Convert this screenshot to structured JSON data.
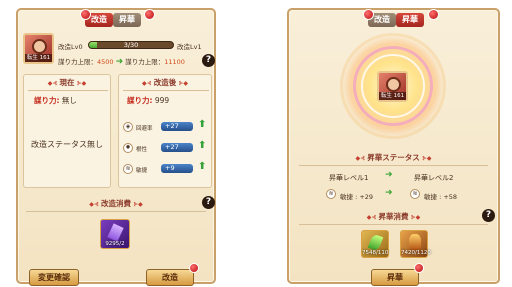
{
  "left": {
    "tabs": [
      {
        "label": "改造"
      },
      {
        "label": "昇華"
      }
    ],
    "hero": {
      "level_badge": "転生 161"
    },
    "progress": {
      "from_label": "改造Lv0",
      "to_label": "改造Lv1",
      "text": "3/30",
      "fraction": 0.1
    },
    "limit": {
      "label": "謀り力上限：",
      "from": "4500",
      "to_label": "謀り力上限：",
      "to": "11100"
    },
    "current": {
      "header": "現在",
      "ability_label": "謀り力:",
      "ability_value": "無し",
      "status_text": "改造ステータス無し"
    },
    "after": {
      "header": "改造後",
      "ability_label": "謀り力:",
      "ability_value": "999",
      "stats": [
        {
          "name": "回避率",
          "value": "+27",
          "icon": "shield-icon"
        },
        {
          "name": "根性",
          "value": "+27",
          "icon": "fire-icon"
        },
        {
          "name": "敏捷",
          "value": "+9",
          "icon": "wind-icon"
        }
      ]
    },
    "cost": {
      "header": "改造消費",
      "item_count": "9295/2"
    },
    "buttons": {
      "confirm": "変更確認",
      "modify": "改造"
    }
  },
  "right": {
    "tabs": [
      {
        "label": "改造"
      },
      {
        "label": "昇華"
      }
    ],
    "hero": {
      "level_badge": "転生 161"
    },
    "sublimation": {
      "header": "昇華ステータス",
      "from_level": "昇華レベル1",
      "to_level": "昇華レベル2",
      "stat_name": "敏捷",
      "from_value": "+29",
      "to_value": "+58"
    },
    "cost": {
      "header": "昇華消費",
      "items": [
        {
          "count": "7548/110",
          "icon": "leaf-gem-icon"
        },
        {
          "count": "7420/1120",
          "icon": "flame-statue-icon"
        }
      ]
    },
    "buttons": {
      "sublimate": "昇華"
    }
  },
  "colors": {
    "panel_bg": "#f6e8cb",
    "border": "#c9a06a",
    "accent_red": "#c0342a",
    "green": "#3aa534",
    "blue_pill": "#2f63a8"
  }
}
